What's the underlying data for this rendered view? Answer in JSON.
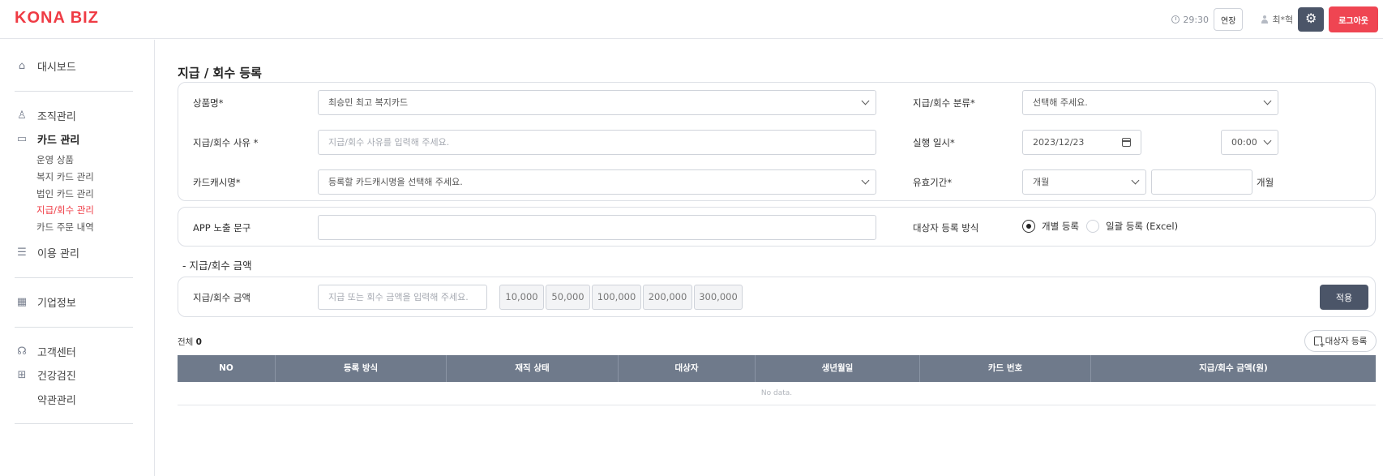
{
  "header": {
    "logo": "KONA BIZ",
    "timer": "29:30",
    "extend_label": "연장",
    "user_name": "최*혁",
    "gear_glyph": "⚙",
    "logout_label": "로그아웃"
  },
  "sidebar": {
    "dashboard": "대시보드",
    "org": "조직관리",
    "card": "카드 관리",
    "card_sub": [
      "운영 상품",
      "복지 카드 관리",
      "법인 카드 관리",
      "지급/회수 관리",
      "카드 주문 내역"
    ],
    "usage": "이용 관리",
    "company": "기업정보",
    "support": "고객센터",
    "health": "건강검진",
    "terms": "약관관리"
  },
  "page": {
    "title": "지급 / 회수 등록"
  },
  "form": {
    "product_label": "상품명*",
    "product_value": "최승민 최고 복지카드",
    "category_label": "지급/회수 분류*",
    "category_value": "선택해 주세요.",
    "reason_label": "지급/회수 사유 *",
    "reason_placeholder": "지급/회수 사유를 입력해 주세요.",
    "exec_label": "실행 일시*",
    "exec_date": "2023/12/23",
    "exec_time": "00:00",
    "cash_label": "카드캐시명*",
    "cash_value": "등록할 카드캐시명을 선택해 주세요.",
    "validity_label": "유효기간*",
    "validity_unit_select": "개월",
    "validity_unit_text": "개월",
    "app_label": "APP 노출 문구",
    "target_label": "대상자 등록 방식",
    "radio_individual": "개별 등록",
    "radio_bulk": "일괄 등록 (Excel)"
  },
  "amount": {
    "section_label": "- 지급/회수 금액",
    "label": "지급/회수 금액",
    "placeholder": "지급 또는 회수 금액을 입력해 주세요.",
    "presets": [
      "10,000",
      "50,000",
      "100,000",
      "200,000",
      "300,000"
    ],
    "apply_label": "적용"
  },
  "list": {
    "total_label": "전체",
    "total_count": "0",
    "register_label": "대상자 등록",
    "columns": [
      "NO",
      "등록 방식",
      "재직 상태",
      "대상자",
      "생년월일",
      "카드 번호",
      "지급/회수 금액(원)"
    ],
    "no_data": "No data."
  }
}
